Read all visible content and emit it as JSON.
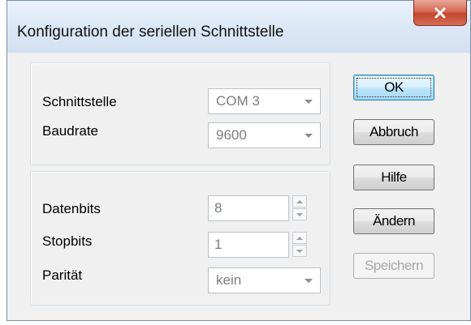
{
  "window": {
    "title": "Konfiguration der seriellen Schnittstelle",
    "close_icon": "close-x-icon"
  },
  "group1": {
    "fields": [
      {
        "label": "Schnittstelle",
        "value": "COM 3"
      },
      {
        "label": "Baudrate",
        "value": "9600"
      }
    ]
  },
  "group2": {
    "fields": [
      {
        "label": "Datenbits",
        "value": "8"
      },
      {
        "label": "Stopbits",
        "value": "1"
      },
      {
        "label": "Parität",
        "value": "kein"
      }
    ]
  },
  "buttons": {
    "ok": "OK",
    "cancel": "Abbruch",
    "help": "Hilfe",
    "change": "Ändern",
    "save": "Speichern"
  },
  "colors": {
    "close_button": "#c4452c",
    "default_button_border": "#3c7fb1",
    "disabled_text": "#a8a8a8"
  }
}
